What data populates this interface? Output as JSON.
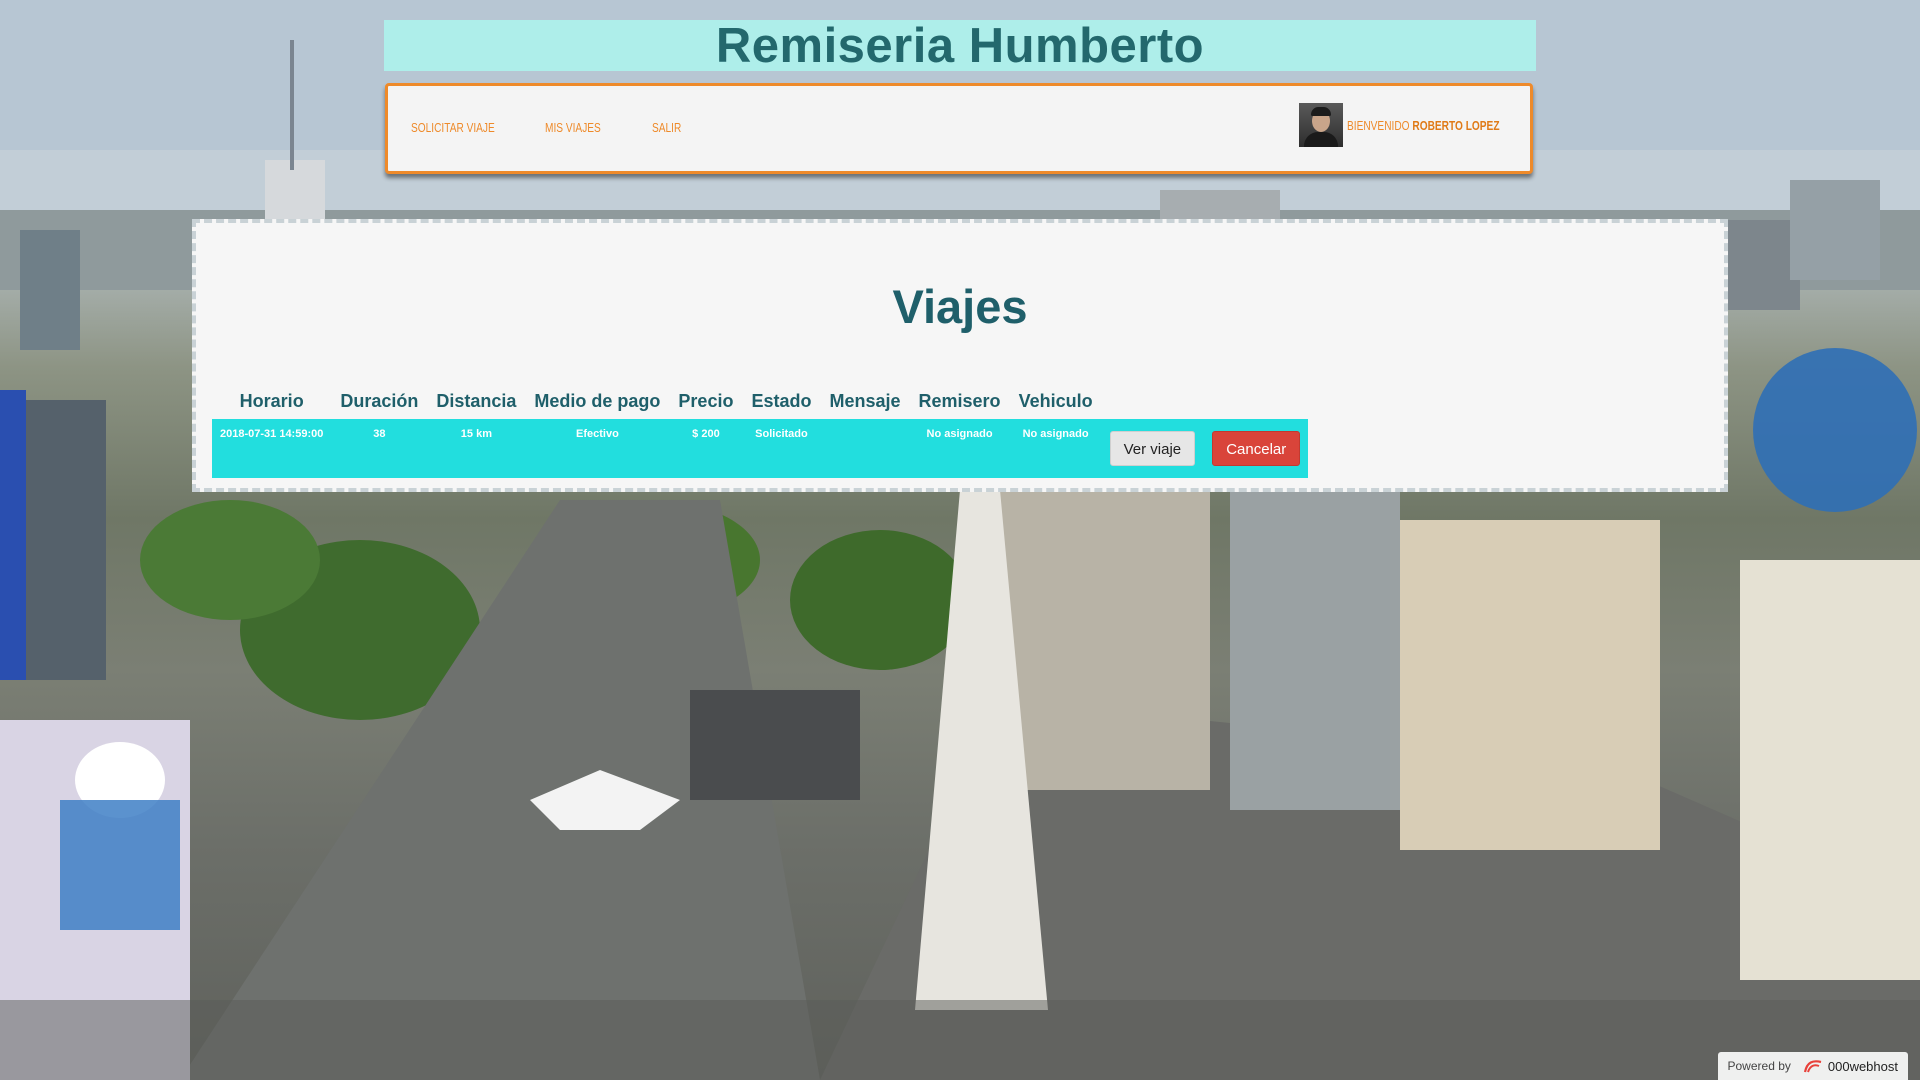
{
  "header": {
    "site_title": "Remiseria Humberto"
  },
  "nav": {
    "items": [
      {
        "label": "Solicitar viaje"
      },
      {
        "label": "Mis viajes"
      },
      {
        "label": "Salir"
      }
    ],
    "welcome_prefix": "Bienvenido",
    "user_name": "Roberto Lopez"
  },
  "main": {
    "title": "Viajes",
    "table": {
      "columns": [
        "Horario",
        "Duración",
        "Distancia",
        "Medio de pago",
        "Precio",
        "Estado",
        "Mensaje",
        "Remisero",
        "Vehiculo"
      ],
      "rows": [
        {
          "horario": "2018-07-31 14:59:00",
          "duracion": "38",
          "distancia": "15 km",
          "medio_pago": "Efectivo",
          "precio": "$ 200",
          "estado": "Solicitado",
          "mensaje": "",
          "remisero": "No asignado",
          "vehiculo": "No asignado",
          "view_label": "Ver viaje",
          "cancel_label": "Cancelar"
        }
      ]
    }
  },
  "footer": {
    "powered_by": "Powered by",
    "brand": "000webhost"
  },
  "colors": {
    "title_bar": "#aeeeea",
    "title_text": "#23686d",
    "nav_accent": "#ee8a2a",
    "row_bg": "#22dede",
    "cancel_bg": "#d9443a"
  },
  "icons": {
    "avatar": "user-avatar-photo",
    "brand_logo": "000webhost-logo-icon"
  }
}
